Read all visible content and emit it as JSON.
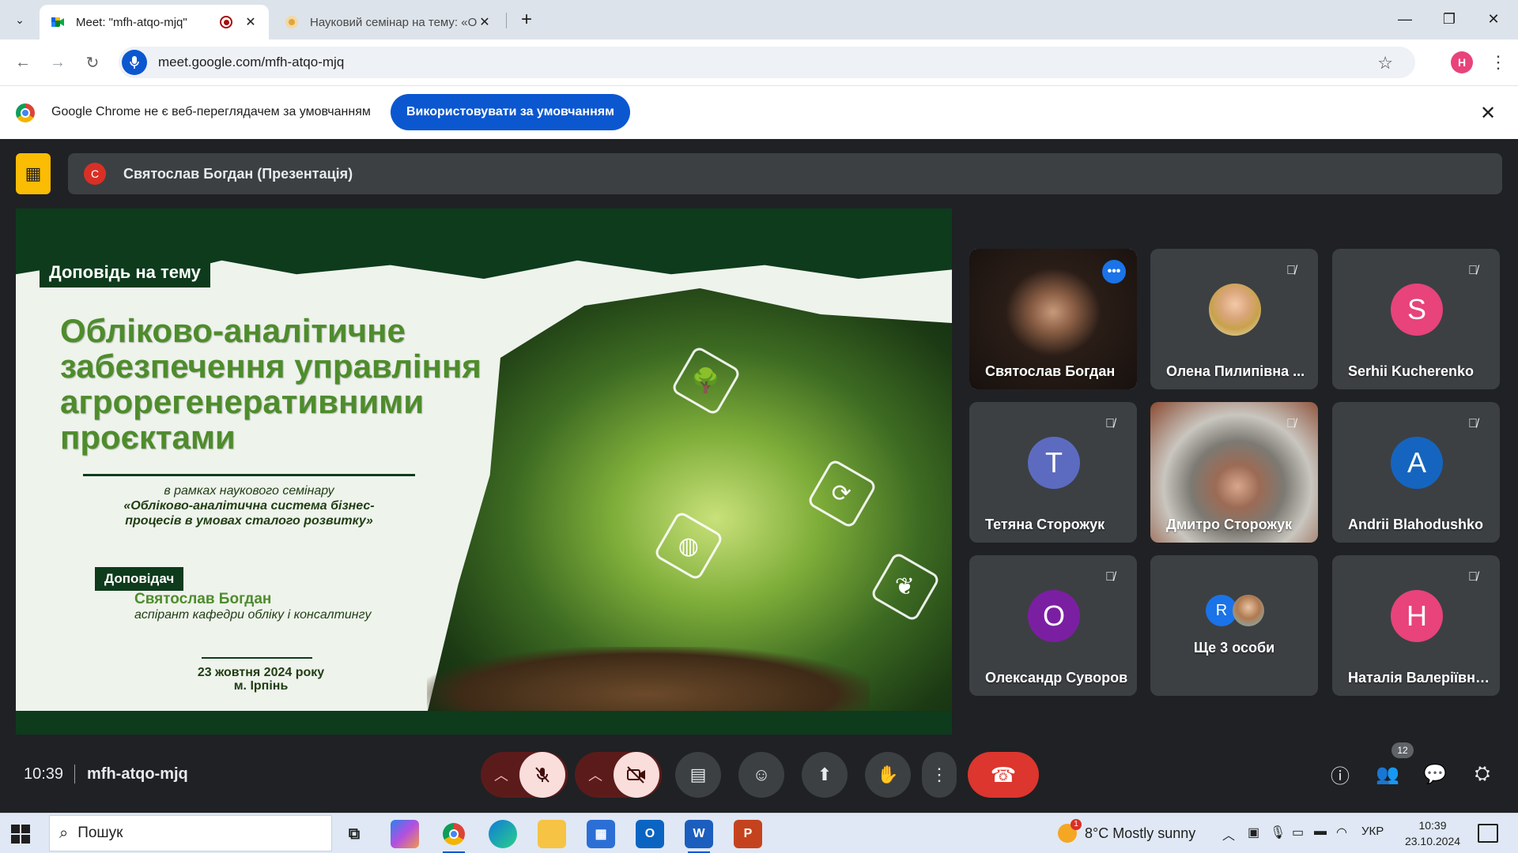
{
  "browser": {
    "tabs": [
      {
        "title": "Meet: \"mfh-atqo-mjq\"",
        "active": true
      },
      {
        "title": "Науковий семінар на тему: «О",
        "active": false
      }
    ],
    "url": "meet.google.com/mfh-atqo-mjq",
    "profile_initial": "H",
    "infobar": {
      "message": "Google Chrome не є веб-переглядачем за умовчанням",
      "button": "Використовувати за умовчанням"
    }
  },
  "presentation": {
    "presenter_initial": "С",
    "presenter_label": "Святослав Богдан (Презентація)"
  },
  "slide": {
    "tag_topic": "Доповідь на тему",
    "title_lines": [
      "Обліково-аналітичне",
      "забезпечення управління",
      "агрорегенеративними",
      "проєктами"
    ],
    "seminar_intro": "в рамках наукового семінару",
    "seminar_title_1": "«Обліково-аналітична система бізнес-",
    "seminar_title_2": "процесів в умовах сталого розвитку»",
    "tag_speaker": "Доповідач",
    "speaker_name": "Святослав Богдан",
    "speaker_role": "аспірант кафедри обліку і консалтингу",
    "date": "23 жовтня 2024 року",
    "city": "м. Ірпінь"
  },
  "participants": [
    {
      "name": "Святослав Богдан",
      "type": "video",
      "speaking": true
    },
    {
      "name": "Олена Пилипівна ...",
      "type": "photo",
      "muted": true
    },
    {
      "name": "Serhii Kucherenko",
      "initial": "S",
      "color": "#e8437a",
      "muted": true
    },
    {
      "name": "Тетяна Сторожук",
      "initial": "T",
      "color": "#5c6bc0",
      "muted": true
    },
    {
      "name": "Дмитро Сторожук",
      "type": "video",
      "muted": true
    },
    {
      "name": "Andrii Blahodushko",
      "initial": "A",
      "color": "#1565c0",
      "muted": true
    },
    {
      "name": "Олександр Суворов",
      "initial": "O",
      "color": "#7b1fa2",
      "muted": true
    },
    {
      "name": "Ще 3 особи",
      "initial": "R",
      "color": "#1a73e8",
      "group": true
    },
    {
      "name": "Наталія Валеріївна...",
      "initial": "H",
      "color": "#e8437a",
      "muted": true
    }
  ],
  "meeting": {
    "time": "10:39",
    "code": "mfh-atqo-mjq",
    "people_count": "12"
  },
  "taskbar": {
    "search_placeholder": "Пошук",
    "weather": "8°C  Mostly sunny",
    "language": "УКР",
    "time": "10:39",
    "date": "23.10.2024"
  }
}
